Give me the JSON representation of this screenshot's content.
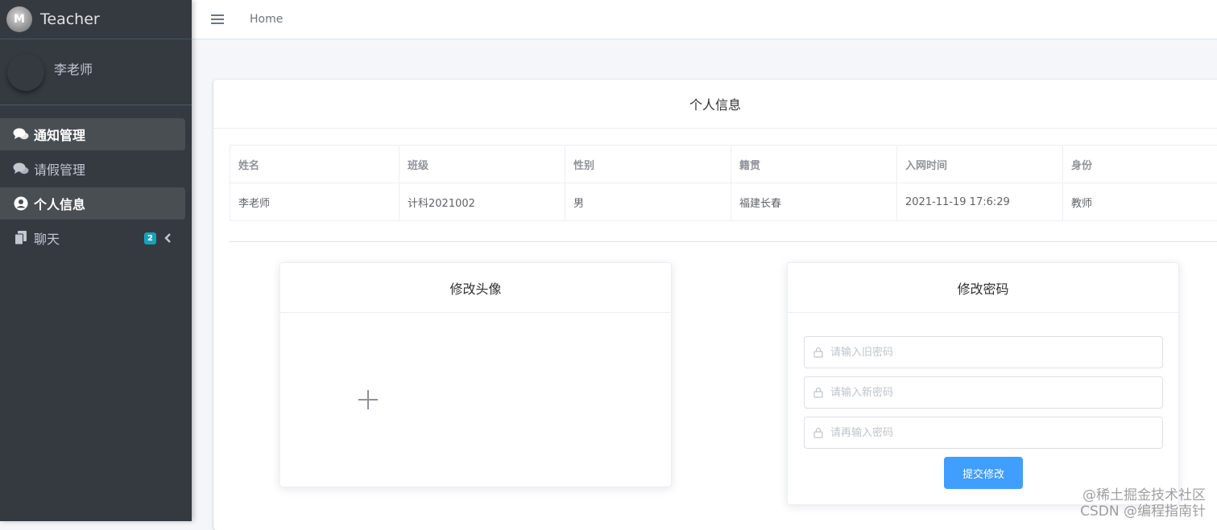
{
  "brand": {
    "name": "Teacher",
    "logo_text": "M"
  },
  "user": {
    "name": "李老师"
  },
  "sidebar": {
    "items": [
      {
        "label": "通知管理",
        "icon": "comments-icon",
        "active": true
      },
      {
        "label": "请假管理",
        "icon": "comments-icon",
        "active": false
      },
      {
        "label": "个人信息",
        "icon": "user-circle-icon",
        "active": true
      },
      {
        "label": "聊天",
        "icon": "copy-icon",
        "badge": "2",
        "active": false
      }
    ]
  },
  "topbar": {
    "home": "Home"
  },
  "profile": {
    "title": "个人信息",
    "columns": [
      "姓名",
      "班级",
      "性别",
      "籍贯",
      "入网时间",
      "身份"
    ],
    "rows": [
      [
        "李老师",
        "计科2021002",
        "男",
        "福建长春",
        "2021-11-19 17:6:29",
        "教师"
      ]
    ]
  },
  "avatar_card": {
    "title": "修改头像"
  },
  "password_card": {
    "title": "修改密码",
    "old_placeholder": "请输入旧密码",
    "new_placeholder": "请输入新密码",
    "confirm_placeholder": "请再输入密码",
    "submit": "提交修改"
  },
  "watermark": {
    "line1": "@稀土掘金技术社区",
    "line2": "CSDN @编程指南针"
  },
  "colors": {
    "sidebar": "#343a40",
    "primary": "#409eff",
    "badge": "#17a2b8"
  }
}
